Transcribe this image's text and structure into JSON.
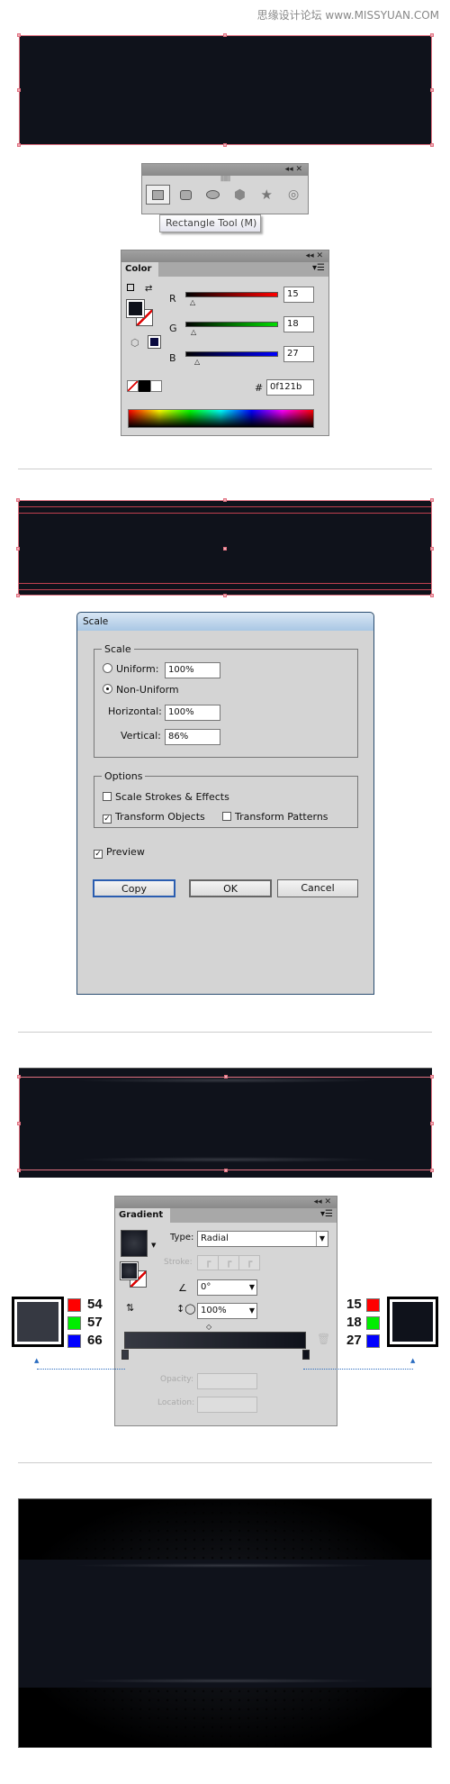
{
  "watermark": "思缘设计论坛 www.MISSYUAN.COM",
  "colors": {
    "artwork": "#0f121b",
    "selection": "#e07080",
    "gradient_start": "#363942",
    "gradient_end": "#0f121b"
  },
  "shape_tools": {
    "panel_controls": "◂◂ ✕",
    "tools": [
      "rectangle-tool-icon",
      "rounded-rectangle-tool-icon",
      "ellipse-tool-icon",
      "polygon-tool-icon",
      "star-tool-icon",
      "flare-tool-icon"
    ],
    "tooltip": "Rectangle Tool (M)"
  },
  "color_panel": {
    "tab": "Color",
    "r_label": "R",
    "g_label": "G",
    "b_label": "B",
    "r": "15",
    "g": "18",
    "b": "27",
    "hash": "#",
    "hex": "0f121b",
    "r_pct": 5.9,
    "g_pct": 7.1,
    "b_pct": 10.6
  },
  "scale_dialog": {
    "title": "Scale",
    "group_scale": "Scale",
    "uniform_label": "Uniform:",
    "uniform_value": "100%",
    "nonuniform_label": "Non-Uniform",
    "horizontal_label": "Horizontal:",
    "horizontal_value": "100%",
    "vertical_label": "Vertical:",
    "vertical_value": "86%",
    "group_options": "Options",
    "scale_strokes": "Scale Strokes & Effects",
    "transform_objects": "Transform Objects",
    "transform_patterns": "Transform Patterns",
    "preview": "Preview",
    "copy": "Copy",
    "ok": "OK",
    "cancel": "Cancel",
    "check": "✓"
  },
  "gradient_panel": {
    "tab": "Gradient",
    "type_label": "Type:",
    "type_value": "Radial",
    "stroke_label": "Stroke:",
    "angle_value": "0°",
    "aspect_value": "100%",
    "opacity_label": "Opacity:",
    "location_label": "Location:",
    "arrow": "▼"
  },
  "left_stop": {
    "r": "54",
    "g": "57",
    "b": "66"
  },
  "right_stop": {
    "r": "15",
    "g": "18",
    "b": "27"
  }
}
